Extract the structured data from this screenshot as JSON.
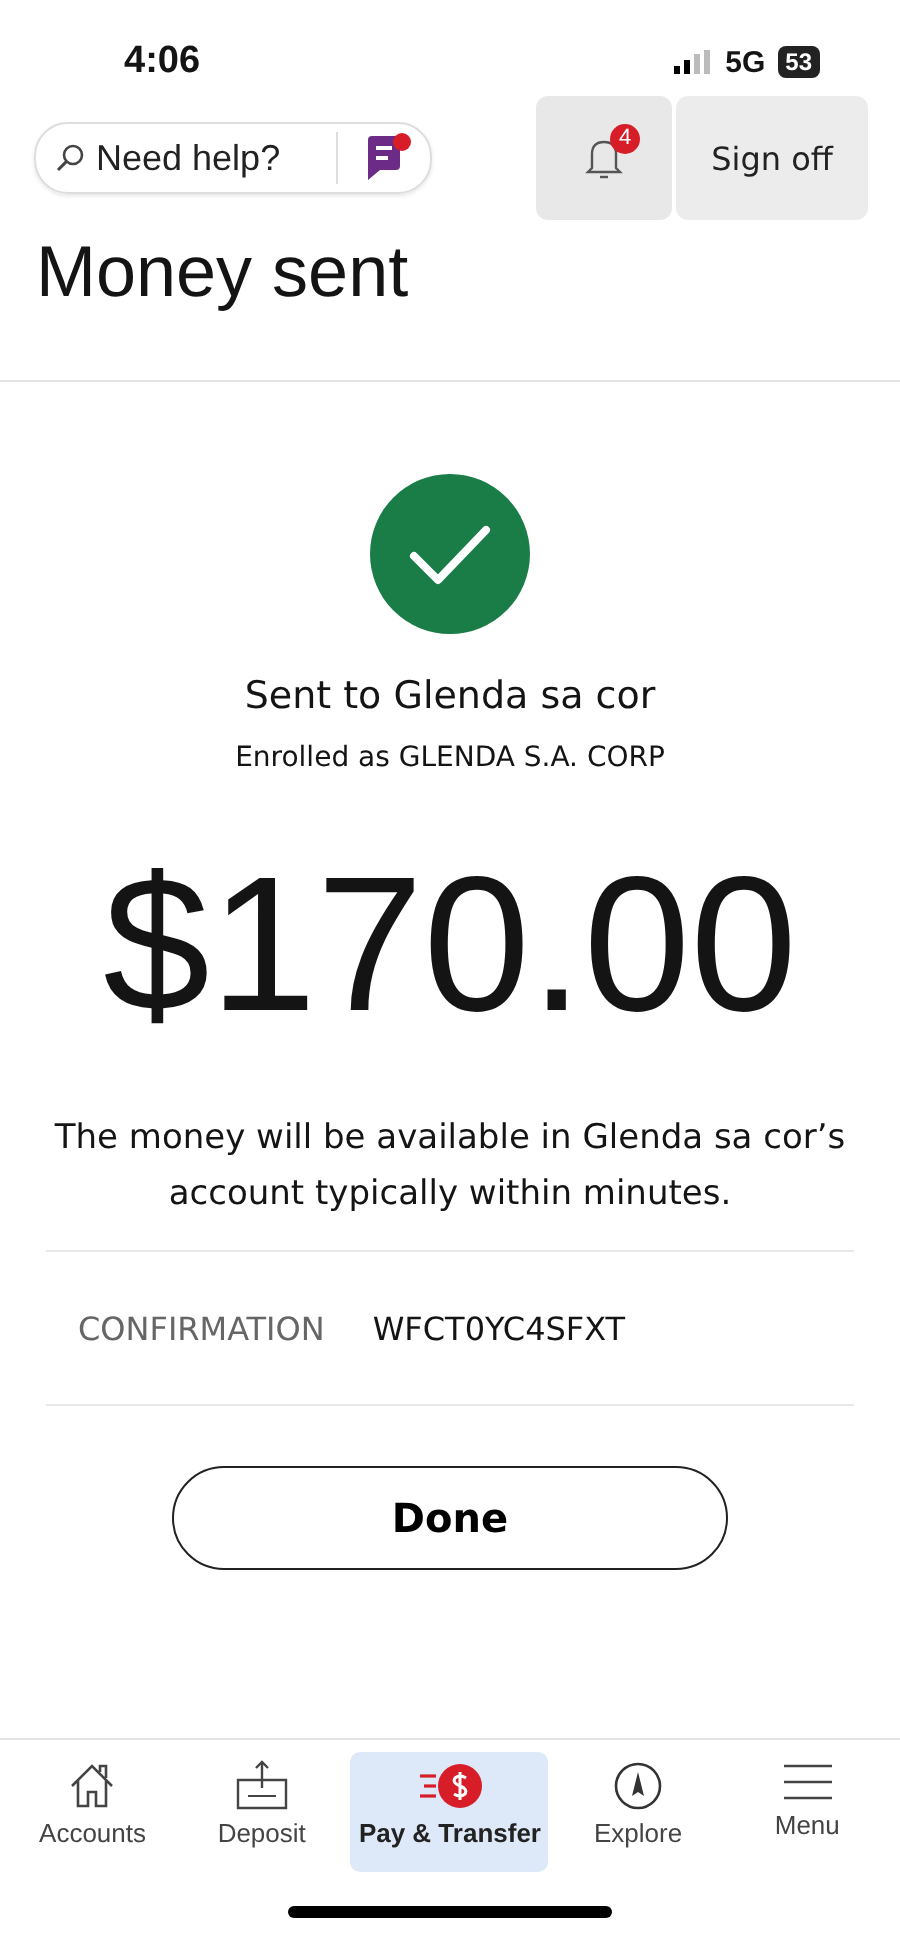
{
  "status_bar": {
    "time": "4:06",
    "network": "5G",
    "battery": "53"
  },
  "header": {
    "help_search": {
      "placeholder": "Need help?"
    },
    "notifications": {
      "count": "4"
    },
    "sign_off": "Sign off"
  },
  "title": "Money sent",
  "confirmation": {
    "recipient": "Sent to Glenda sa cor",
    "enrolled": "Enrolled as GLENDA S.A. CORP",
    "amount": "$170.00",
    "message": "The money will be available in Glenda sa cor’s account typically within minutes.",
    "label": "CONFIRMATION",
    "code": "WFCT0YC4SFXT"
  },
  "done_button": "Done",
  "bottom_nav": [
    {
      "label": "Accounts",
      "kind": "home",
      "selected": false
    },
    {
      "label": "Deposit",
      "kind": "deposit",
      "selected": false
    },
    {
      "label": "Pay & Transfer",
      "kind": "pay",
      "selected": true
    },
    {
      "label": "Explore",
      "kind": "compass",
      "selected": false
    },
    {
      "label": "Menu",
      "kind": "menu",
      "selected": false
    }
  ]
}
